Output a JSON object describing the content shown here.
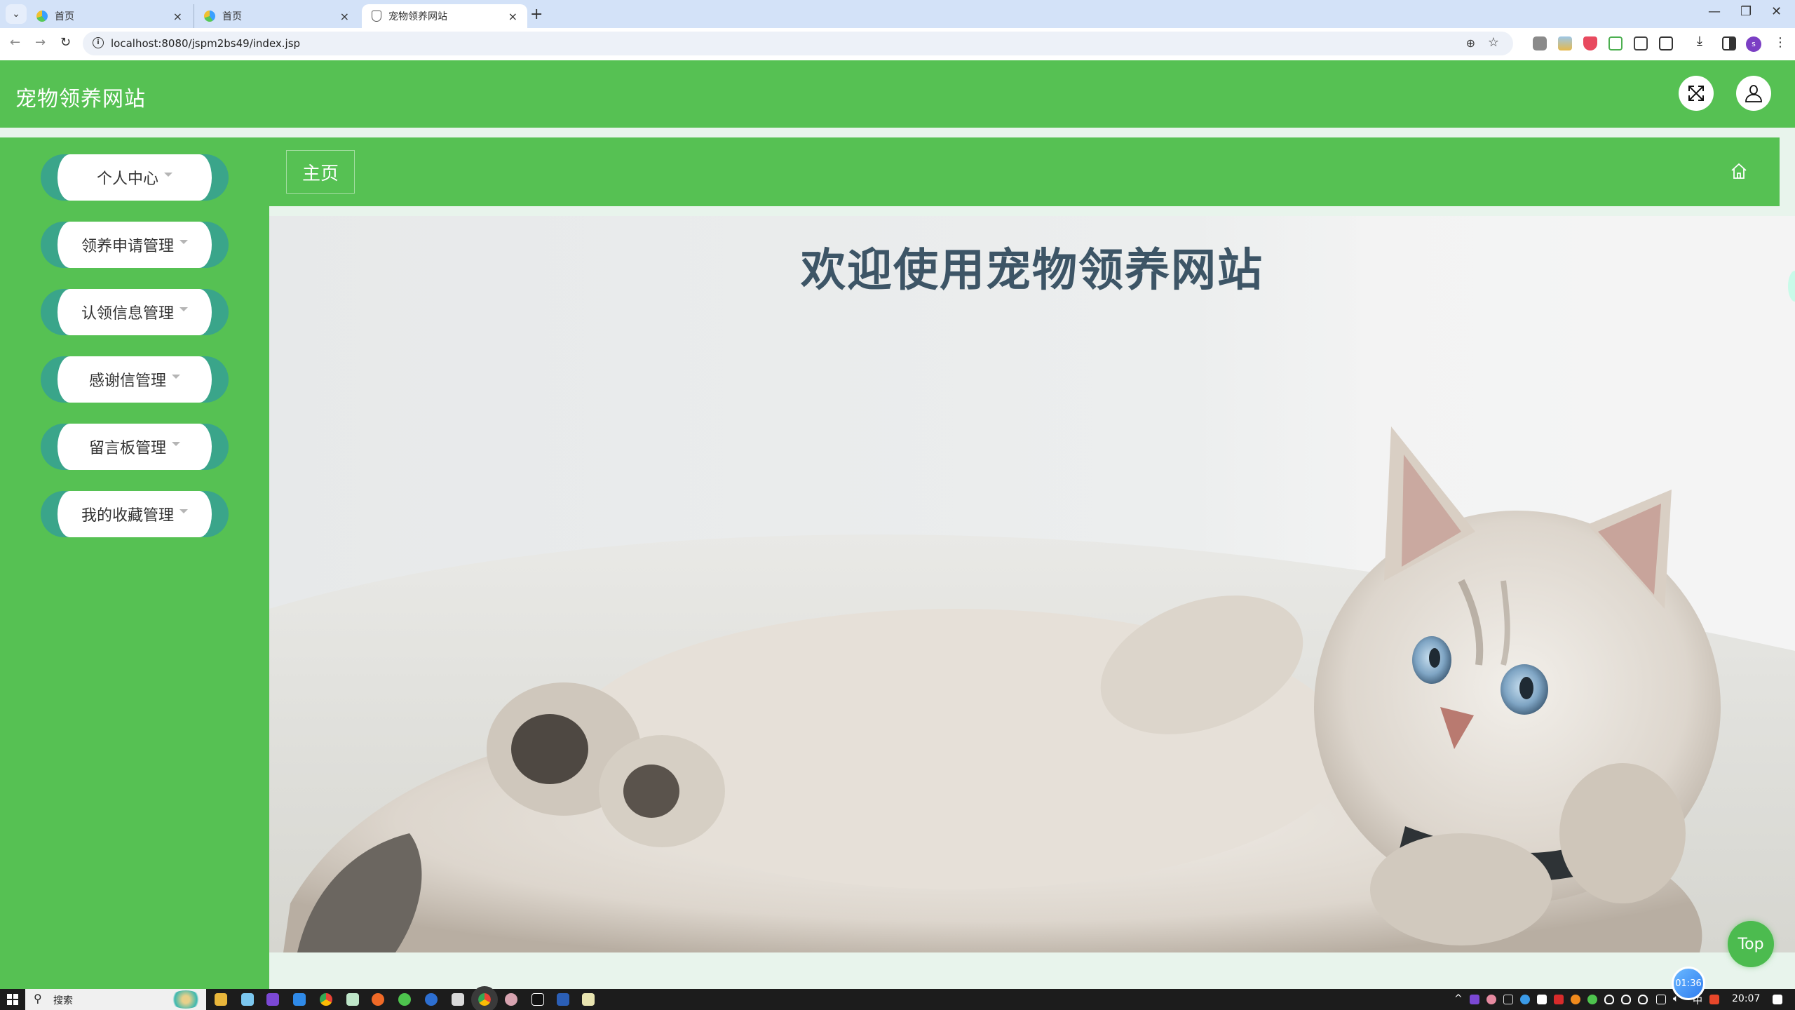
{
  "browser": {
    "tabs": [
      {
        "title": "首页",
        "active": false
      },
      {
        "title": "首页",
        "active": false
      },
      {
        "title": "宠物领养网站",
        "active": true
      }
    ],
    "new_tab_label": "+",
    "close_glyph": "×",
    "url": "localhost:8080/jspm2bs49/index.jsp",
    "profile_initial": "s",
    "window_controls": {
      "minimize": "—",
      "restore": "❐",
      "close": "✕"
    }
  },
  "header": {
    "title": "宠物领养网站",
    "fullscreen_icon": "fullscreen-icon",
    "user_icon": "user-icon"
  },
  "sidebar": {
    "items": [
      {
        "label": "个人中心"
      },
      {
        "label": "领养申请管理"
      },
      {
        "label": "认领信息管理"
      },
      {
        "label": "感谢信管理"
      },
      {
        "label": "留言板管理"
      },
      {
        "label": "我的收藏管理"
      }
    ]
  },
  "breadcrumb": {
    "current": "主页",
    "home_icon": "home-icon"
  },
  "main": {
    "welcome": "欢迎使用宠物领养网站",
    "banner_image": "kitten-photo"
  },
  "floating": {
    "top_button": "Top",
    "timer": "01:36"
  },
  "colors": {
    "brand_green": "#56c153",
    "menu_accent": "#3aa58a",
    "welcome_text": "#3d5566",
    "page_bg": "#e8f4ec"
  },
  "taskbar": {
    "search_placeholder": "搜索",
    "clock": "20:07",
    "ime": "中"
  }
}
